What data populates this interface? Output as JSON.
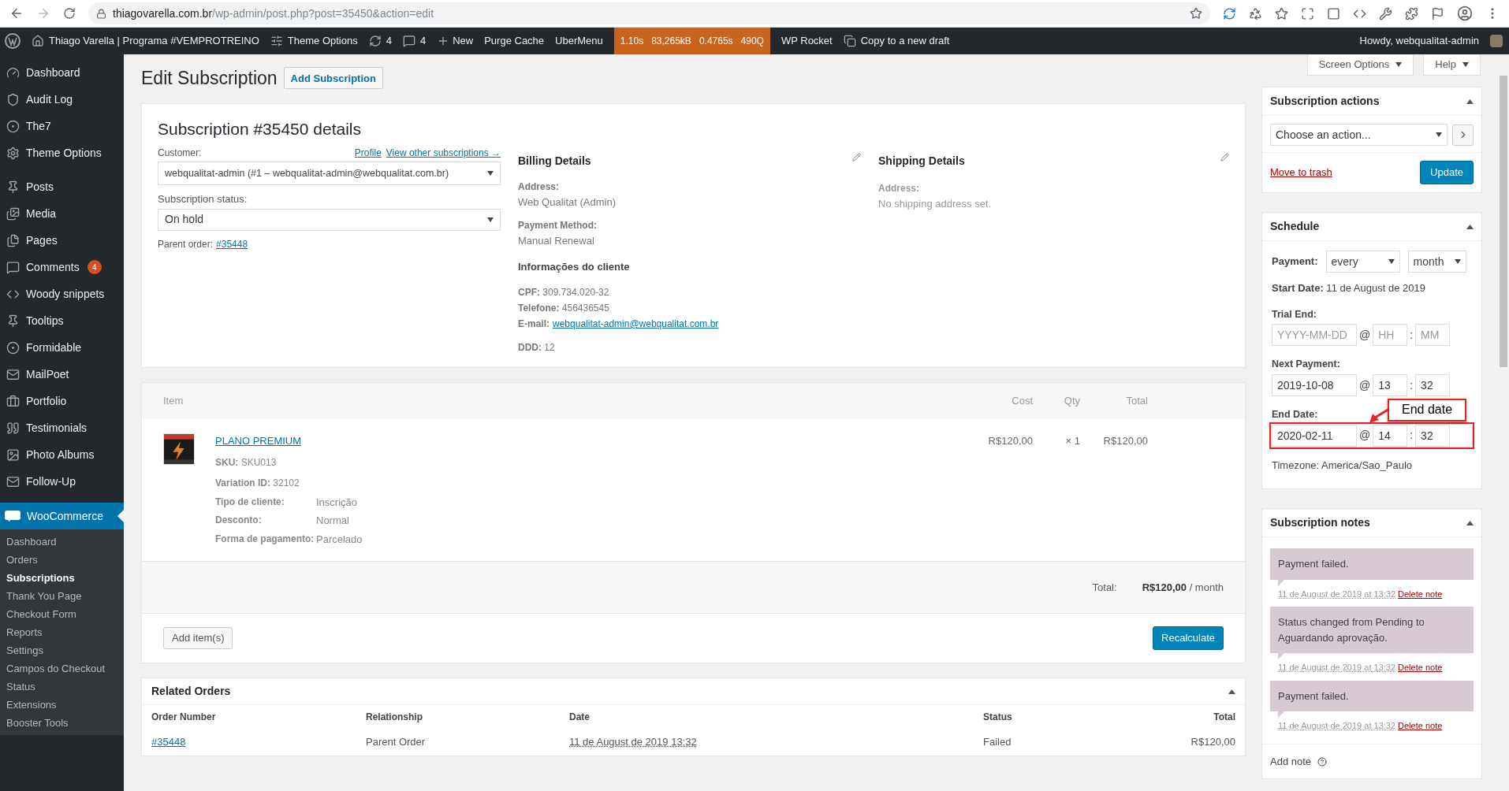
{
  "browser": {
    "url_host": "thiagovarella.com.br",
    "url_path": "/wp-admin/post.php?post=35450&action=edit"
  },
  "admin_bar": {
    "site": "Thiago Varella | Programa #VEMPROTREINO",
    "theme_options": "Theme Options",
    "updates": "4",
    "comments": "4",
    "new": "New",
    "purge": "Purge Cache",
    "ubermenu": "UberMenu",
    "stats": [
      "1.10s",
      "83,265kB",
      "0.4765s",
      "490Q"
    ],
    "rocket": "WP Rocket",
    "copy": "Copy to a new draft",
    "howdy": "Howdy, webqualitat-admin"
  },
  "sidebar": {
    "items": [
      {
        "label": "Dashboard",
        "selected": false
      },
      {
        "label": "Audit Log",
        "selected": false
      },
      {
        "label": "The7",
        "selected": false
      },
      {
        "label": "Theme Options",
        "selected": false
      },
      {
        "label": "Posts",
        "selected": false
      },
      {
        "label": "Media",
        "selected": false
      },
      {
        "label": "Pages",
        "selected": false
      },
      {
        "label": "Comments",
        "badge": "4",
        "selected": false
      },
      {
        "label": "Woody snippets",
        "selected": false
      },
      {
        "label": "Tooltips",
        "selected": false
      },
      {
        "label": "Formidable",
        "selected": false
      },
      {
        "label": "MailPoet",
        "selected": false
      },
      {
        "label": "Portfolio",
        "selected": false
      },
      {
        "label": "Testimonials",
        "selected": false
      },
      {
        "label": "Photo Albums",
        "selected": false
      },
      {
        "label": "Follow-Up",
        "selected": false
      }
    ],
    "current": {
      "label": "WooCommerce",
      "selected": true
    },
    "submenu": [
      {
        "label": "Dashboard",
        "selected": false
      },
      {
        "label": "Orders",
        "selected": false
      },
      {
        "label": "Subscriptions",
        "selected": true
      },
      {
        "label": "Thank You Page",
        "selected": false
      },
      {
        "label": "Checkout Form",
        "selected": false
      },
      {
        "label": "Reports",
        "selected": false
      },
      {
        "label": "Settings",
        "selected": false
      },
      {
        "label": "Campos do Checkout",
        "selected": false
      },
      {
        "label": "Status",
        "selected": false
      },
      {
        "label": "Extensions",
        "selected": false
      },
      {
        "label": "Booster Tools",
        "selected": false
      }
    ]
  },
  "page": {
    "title": "Edit Subscription",
    "add_button": "Add Subscription",
    "screen_options": "Screen Options",
    "help": "Help"
  },
  "details": {
    "title": "Subscription #35450 details",
    "customer_label": "Customer:",
    "profile_link": "Profile",
    "other_link": "View other subscriptions →",
    "customer": "webqualitat-admin (#1 – webqualitat-admin@webqualitat.com.br)",
    "status_label": "Subscription status:",
    "status": "On hold",
    "parent_label": "Parent order:",
    "parent_link": "#35448",
    "billing": {
      "title": "Billing Details",
      "address_label": "Address:",
      "address": "Web Qualitat (Admin)",
      "payment_label": "Payment Method:",
      "payment": "Manual Renewal",
      "client_title": "Informações do cliente",
      "lines": [
        "**CPF:** 309.734.020-32",
        "**Telefone:** 456436545"
      ],
      "email_label": "E-mail:",
      "email": "webqualitat-admin@webqualitat.com.br",
      "ddd": "**DDD:** 12"
    },
    "shipping": {
      "title": "Shipping Details",
      "address_label": "Address:",
      "address": "No shipping address set."
    }
  },
  "items": {
    "columns": [
      "Item",
      "Cost",
      "Qty",
      "Total"
    ],
    "rows": [
      {
        "name": "PLANO PREMIUM",
        "sku": "**SKU:** SKU013",
        "variation": "**Variation ID:** 32102",
        "meta": [
          {
            "key": "Tipo de cliente:",
            "value": "Inscrição"
          },
          {
            "key": "Desconto:",
            "value": "Normal"
          },
          {
            "key": "Forma de pagamento:",
            "value": "Parcelado"
          }
        ],
        "cost": "R$120,00",
        "qty": "× 1",
        "total": "R$120,00"
      }
    ],
    "total_label": "Total:",
    "total": "R$120,00",
    "period": "/ month",
    "add_button": "Add item(s)",
    "recalc_button": "Recalculate"
  },
  "related": {
    "title": "Related Orders",
    "columns": [
      "Order Number",
      "Relationship",
      "Date",
      "Status",
      "Total"
    ],
    "rows": [
      {
        "number": "#35448",
        "relationship": "Parent Order",
        "date": "11 de August de 2019 13:32",
        "status": "Failed",
        "total": "R$120,00"
      }
    ]
  },
  "actions": {
    "title": "Subscription actions",
    "select": "Choose an action...",
    "trash": "Move to trash",
    "update": "Update"
  },
  "schedule": {
    "title": "Schedule",
    "payment_label": "Payment:",
    "interval": "every",
    "period": "month",
    "start": "**Start Date:** 11 de August de 2019",
    "dates": [
      {
        "label": "Trial End:",
        "date": {
          "placeholder": "YYYY-MM-DD"
        },
        "hour": {
          "placeholder": "HH"
        },
        "minute": {
          "placeholder": "MM"
        },
        "highlighted": false
      },
      {
        "label": "Next Payment:",
        "date": {
          "value": "2019-10-08"
        },
        "hour": {
          "value": "13"
        },
        "minute": {
          "value": "32"
        },
        "highlighted": false
      },
      {
        "label": "End Date:",
        "date": {
          "value": "2020-02-11"
        },
        "hour": {
          "value": "14"
        },
        "minute": {
          "value": "32"
        },
        "highlighted": true
      }
    ],
    "at": "@",
    "colon": ":",
    "timezone": "Timezone: America/Sao_Paulo",
    "callout": "End date"
  },
  "notes": {
    "title": "Subscription notes",
    "items": [
      {
        "text": "Payment failed.",
        "date": "11 de August de 2019 at 13:32",
        "delete": "Delete note"
      },
      {
        "text": "Status changed from Pending to Aguardando aprovação.",
        "date": "11 de August de 2019 at 13:32",
        "delete": "Delete note"
      },
      {
        "text": "Payment failed.",
        "date": "11 de August de 2019 at 13:32",
        "delete": "Delete note"
      }
    ],
    "add_label": "Add note"
  }
}
